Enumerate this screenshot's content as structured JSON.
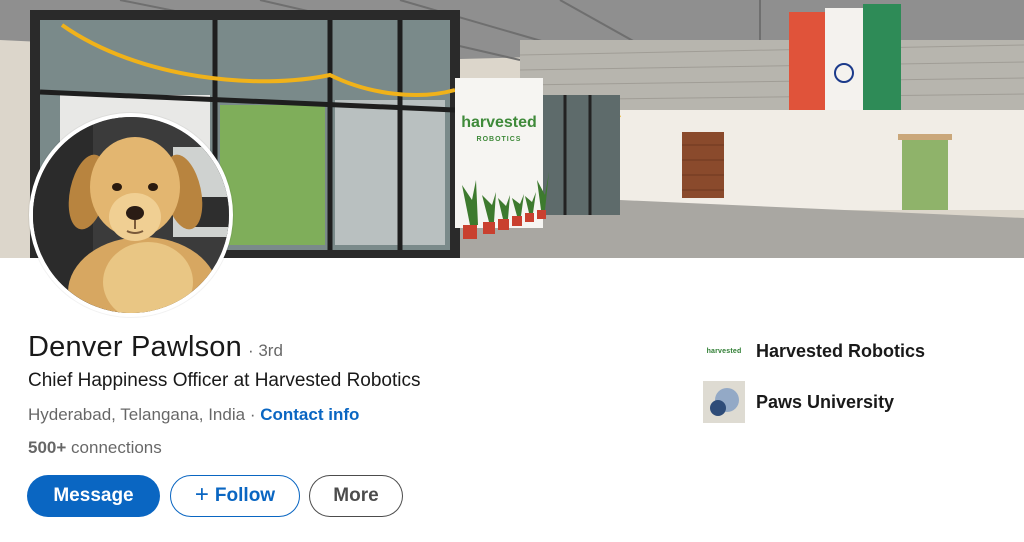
{
  "profile": {
    "name": "Denver Pawlson",
    "degree": "· 3rd",
    "headline": "Chief Happiness Officer at Harvested Robotics",
    "location": "Hyderabad, Telangana, India",
    "separator": "·",
    "contact_info_label": "Contact info",
    "connections_count": "500+",
    "connections_label": "connections"
  },
  "actions": {
    "message_label": "Message",
    "follow_plus": "+",
    "follow_label": "Follow",
    "more_label": "More"
  },
  "cover": {
    "wall_sign_line1": "harvested",
    "wall_sign_line2": "ROBOTICS"
  },
  "orgs": [
    {
      "name": "Harvested Robotics",
      "logo_text": "harvested",
      "icon": "harvested-robotics-logo"
    },
    {
      "name": "Paws University",
      "icon": "paws-university-logo"
    }
  ],
  "colors": {
    "primary": "#0a66c2",
    "text": "#1f1f1f",
    "muted": "#666666"
  }
}
